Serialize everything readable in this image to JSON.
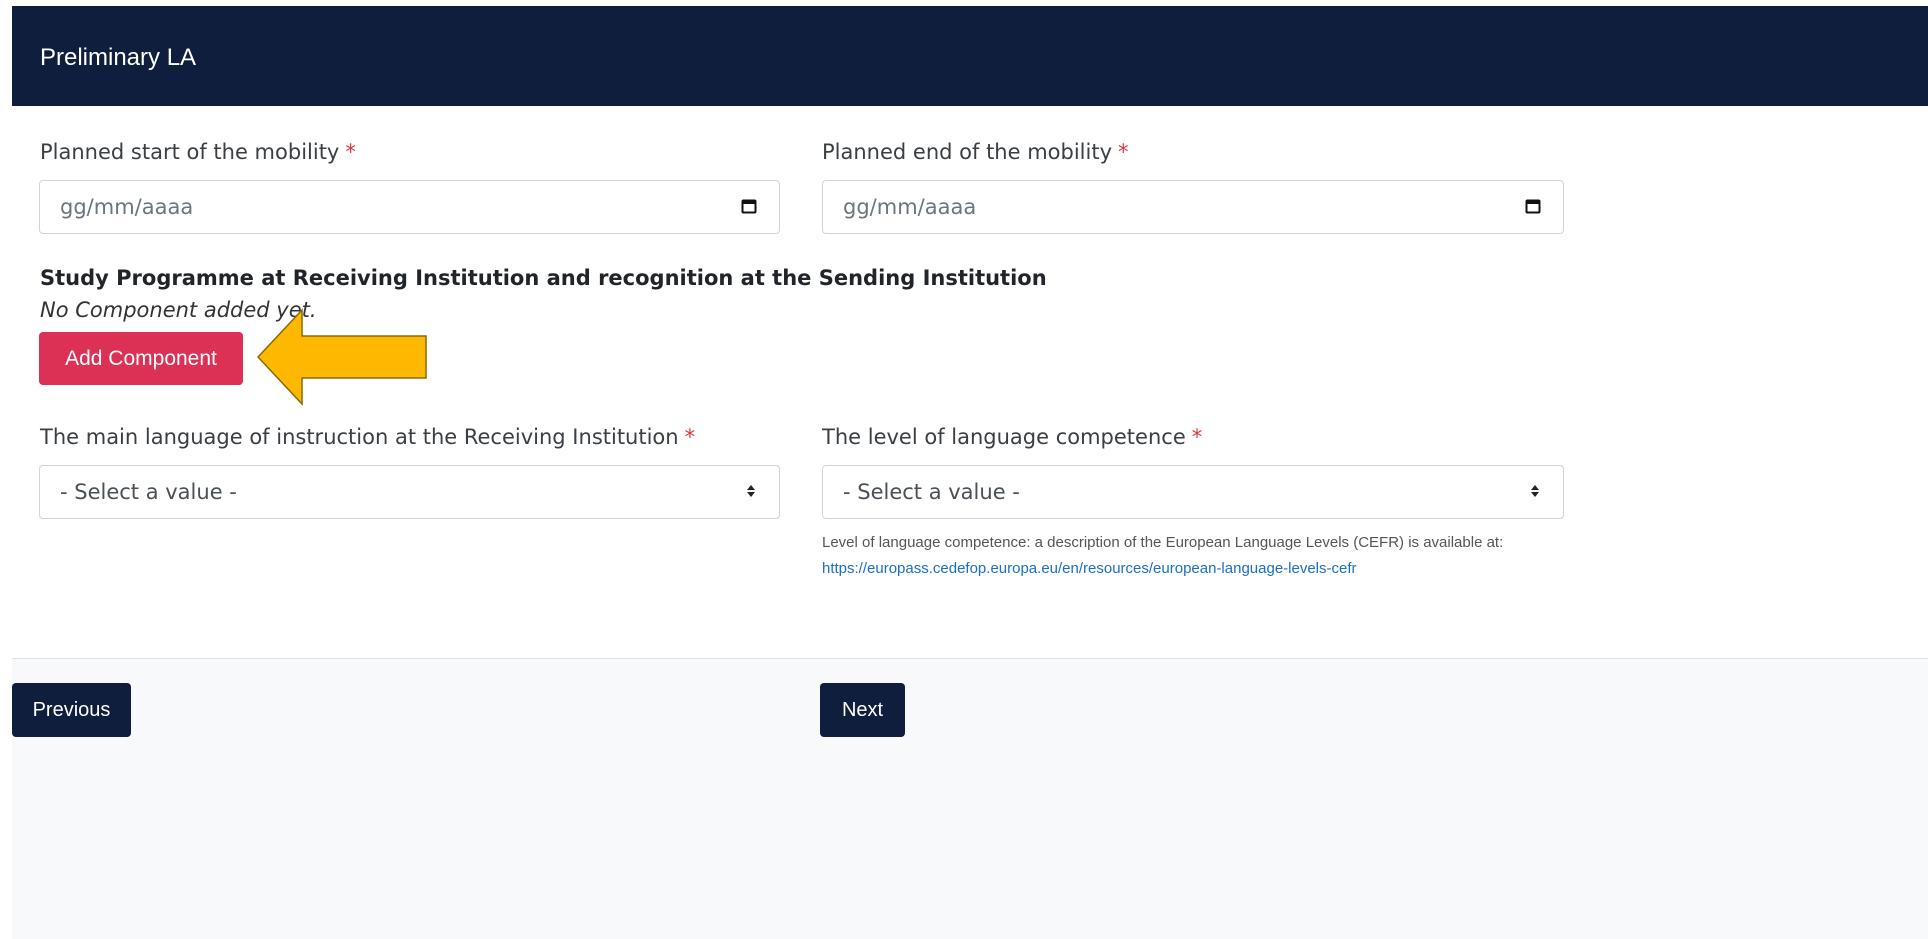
{
  "header": {
    "title": "Preliminary LA"
  },
  "fields": {
    "start": {
      "label": "Planned start of the mobility",
      "required": "*",
      "placeholder": "gg/mm/aaaa"
    },
    "end": {
      "label": "Planned end of the mobility",
      "required": "*",
      "placeholder": "gg/mm/aaaa"
    },
    "language": {
      "label": "The main language of instruction at the Receiving Institution",
      "required": "*",
      "selected": "- Select a value -"
    },
    "level": {
      "label": "The level of language competence",
      "required": "*",
      "selected": "- Select a value -"
    }
  },
  "study": {
    "title": "Study Programme at Receiving Institution and recognition at the Sending Institution",
    "empty_note": "No Component added yet.",
    "add_label": "Add Component"
  },
  "help": {
    "text": "Level of language competence: a description of the European Language Levels (CEFR) is available at: ",
    "link": "https://europass.cedefop.europa.eu/en/resources/european-language-levels-cefr"
  },
  "nav": {
    "previous": "Previous",
    "next": "Next"
  },
  "colors": {
    "header_bg": "#0f1e3c",
    "primary_btn": "#dc3055",
    "arrow": "#ffb800",
    "required": "#dc3545"
  },
  "icons": {
    "date": "calendar-icon",
    "select": "sort-arrows-icon",
    "pointer": "arrow-left-icon"
  }
}
